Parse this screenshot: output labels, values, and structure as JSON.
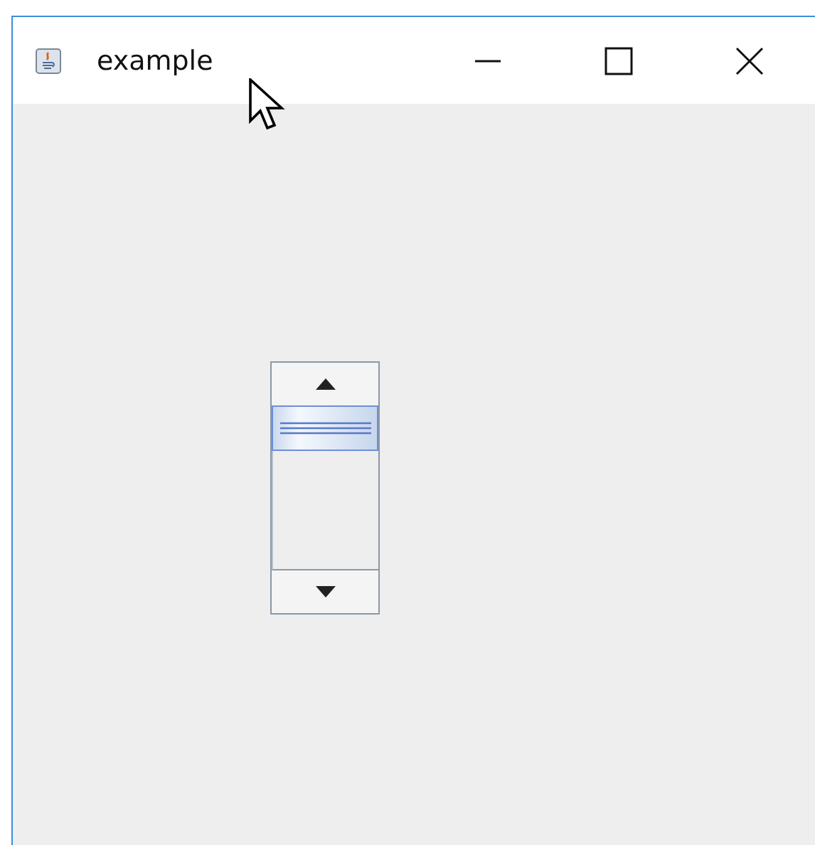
{
  "window": {
    "title": "example"
  }
}
